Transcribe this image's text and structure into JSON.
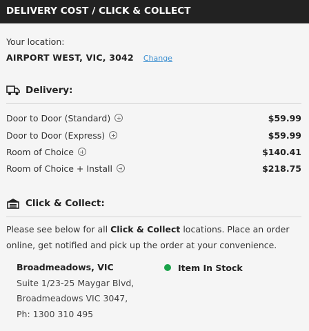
{
  "header": {
    "title": "DELIVERY COST / CLICK & COLLECT"
  },
  "location": {
    "label": "Your location:",
    "value": "AIRPORT WEST, VIC, 3042",
    "change_label": "Change"
  },
  "delivery": {
    "title": "Delivery:",
    "icon": "truck-icon",
    "options": [
      {
        "name": "Door to Door (Standard)",
        "price": "$59.99"
      },
      {
        "name": "Door to Door (Express)",
        "price": "$59.99"
      },
      {
        "name": "Room of Choice",
        "price": "$140.41"
      },
      {
        "name": "Room of Choice + Install",
        "price": "$218.75"
      }
    ]
  },
  "click_collect": {
    "title": "Click & Collect:",
    "icon": "store-icon",
    "text_before": "Please see below for all ",
    "text_bold": "Click & Collect",
    "text_after": " locations. Place an order online, get notified and pick up the order at your convenience.",
    "store": {
      "name": "Broadmeadows, VIC",
      "address1": "Suite 1/23-25 Maygar Blvd,",
      "address2": "Broadmeadows VIC 3047,",
      "phone": "Ph: 1300 310 495",
      "stock_status": "Item In Stock",
      "stock_color": "#1aa34a"
    }
  }
}
